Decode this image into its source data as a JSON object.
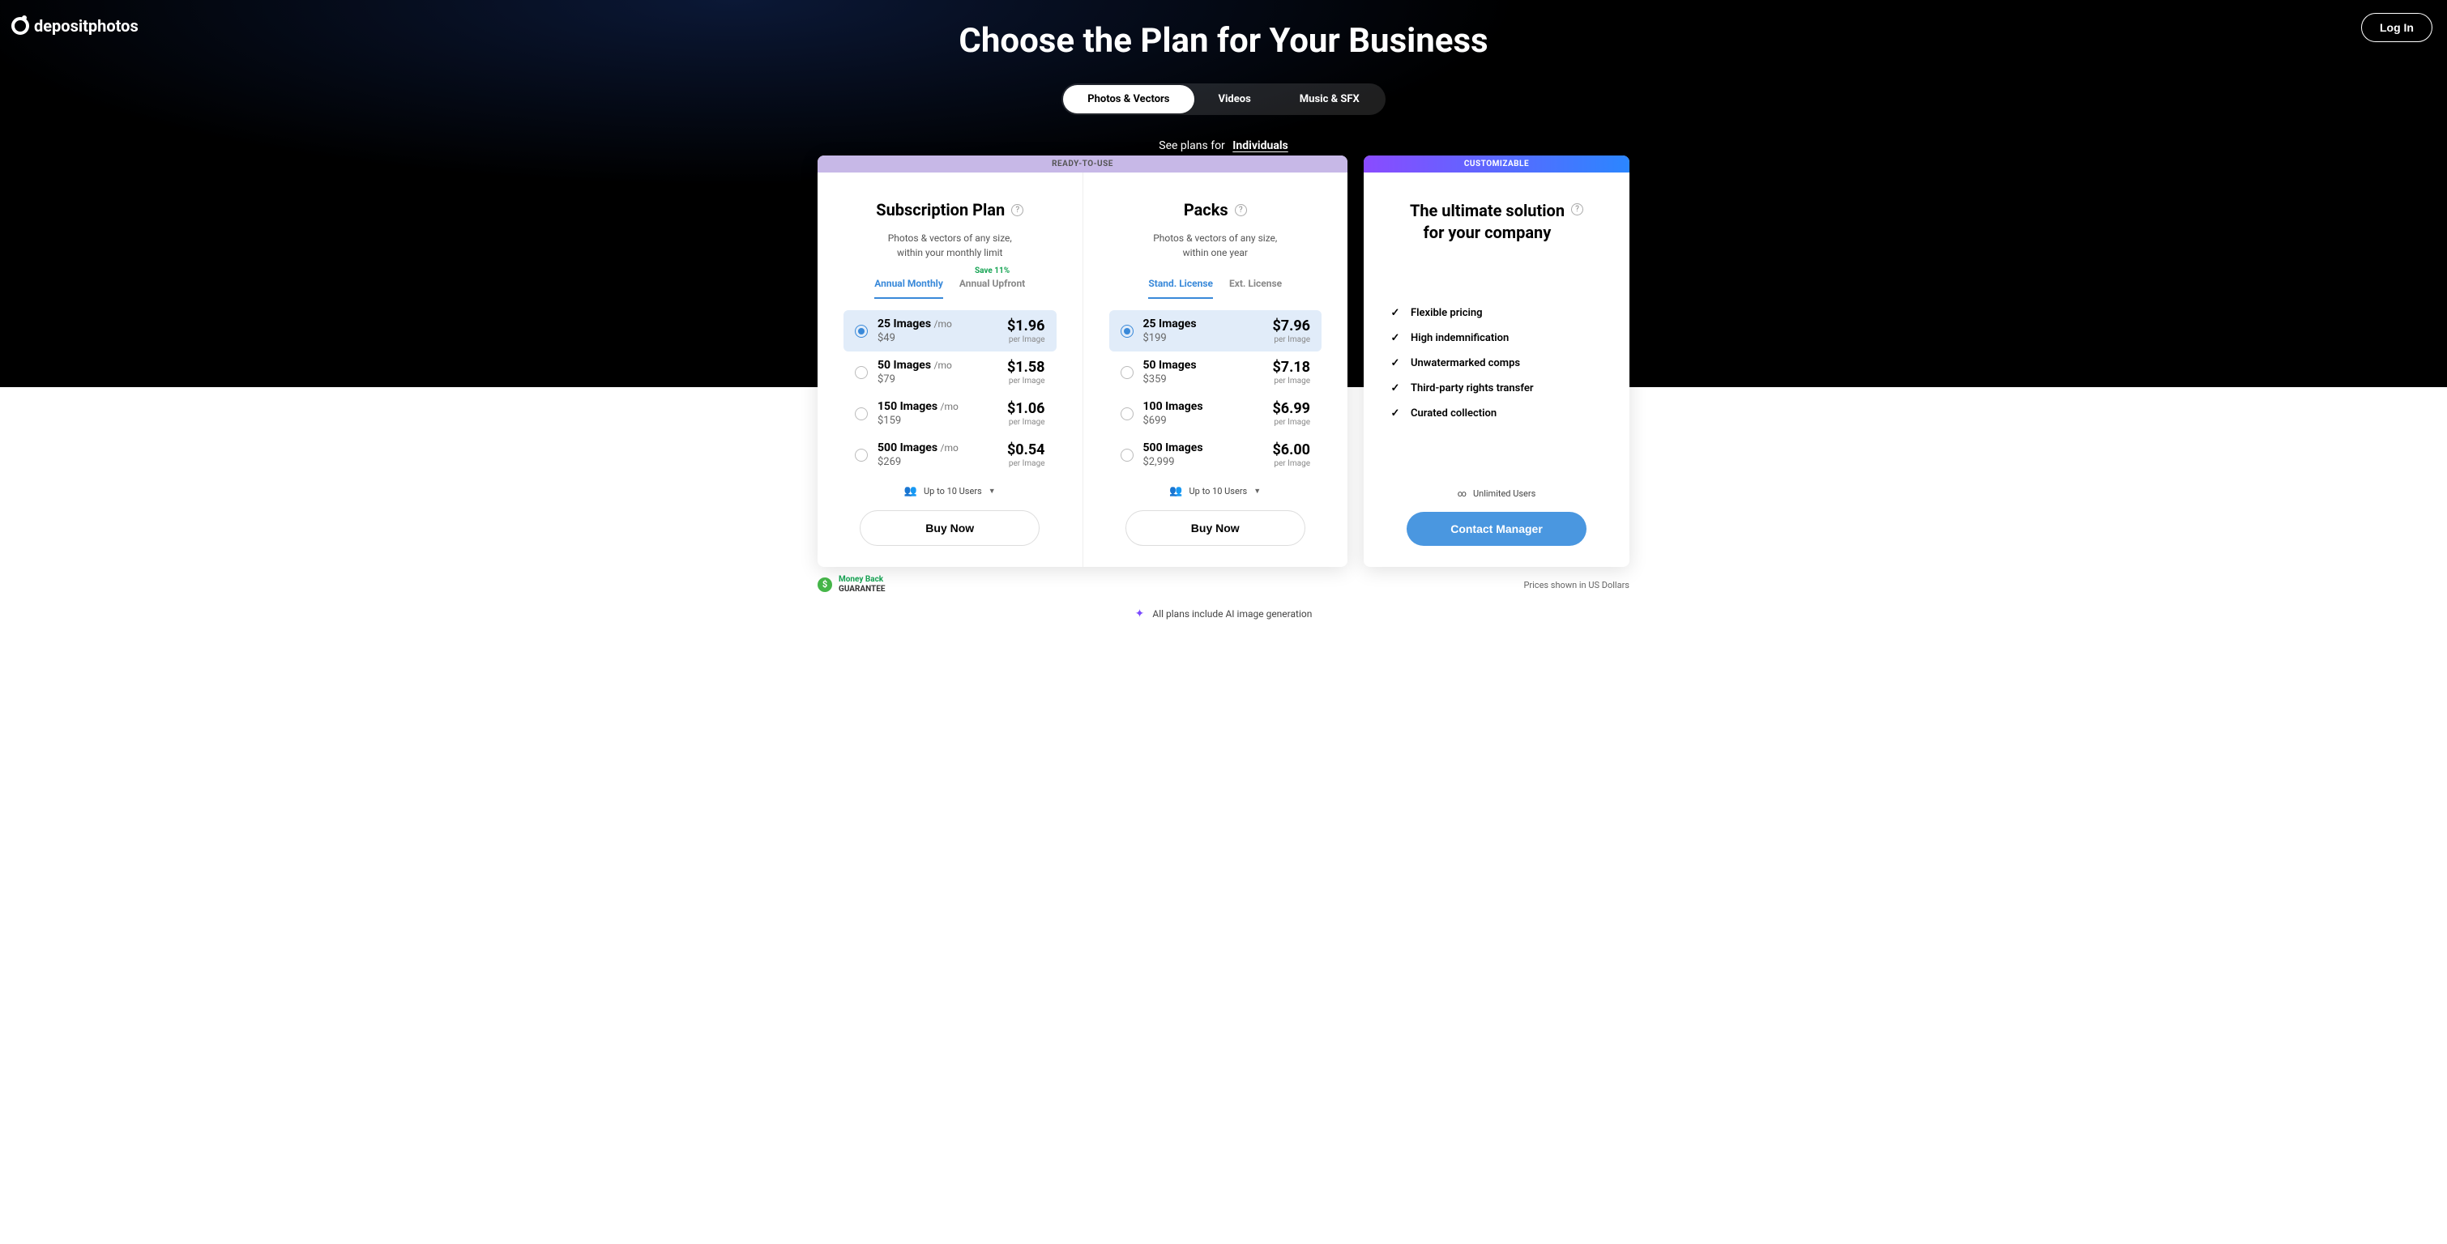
{
  "brand": "depositphotos",
  "login": "Log In",
  "hero_title": "Choose the Plan for Your Business",
  "tabs": {
    "photos": "Photos & Vectors",
    "videos": "Videos",
    "music": "Music & SFX"
  },
  "see_plans": {
    "prefix": "See plans for",
    "link": "Individuals"
  },
  "banners": {
    "ready": "READY-TO-USE",
    "custom": "CUSTOMIZABLE"
  },
  "subscription": {
    "title": "Subscription Plan",
    "sub1": "Photos & vectors of any size,",
    "sub2": "within your monthly limit",
    "tab1": "Annual Monthly",
    "tab2": "Annual Upfront",
    "save": "Save 11%",
    "per": "per Image",
    "mo": "/mo",
    "options": [
      {
        "name": "25 Images",
        "total": "$49",
        "price": "$1.96"
      },
      {
        "name": "50 Images",
        "total": "$79",
        "price": "$1.58"
      },
      {
        "name": "150 Images",
        "total": "$159",
        "price": "$1.06"
      },
      {
        "name": "500 Images",
        "total": "$269",
        "price": "$0.54"
      }
    ],
    "users": "Up to 10 Users",
    "buy": "Buy Now"
  },
  "packs": {
    "title": "Packs",
    "sub1": "Photos & vectors of any size,",
    "sub2": "within one year",
    "tab1": "Stand. License",
    "tab2": "Ext. License",
    "per": "per Image",
    "options": [
      {
        "name": "25 Images",
        "total": "$199",
        "price": "$7.96"
      },
      {
        "name": "50 Images",
        "total": "$359",
        "price": "$7.18"
      },
      {
        "name": "100 Images",
        "total": "$699",
        "price": "$6.99"
      },
      {
        "name": "500 Images",
        "total": "$2,999",
        "price": "$6.00"
      }
    ],
    "users": "Up to 10 Users",
    "buy": "Buy Now"
  },
  "ultimate": {
    "title1": "The ultimate solution",
    "title2": "for your company",
    "features": [
      "Flexible pricing",
      "High indemnification",
      "Unwatermarked comps",
      "Third-party rights transfer",
      "Curated collection"
    ],
    "unlimited": "Unlimited Users",
    "contact": "Contact Manager"
  },
  "footer": {
    "money1": "Money Back",
    "money2": "GUARANTEE",
    "currency": "Prices shown in US Dollars",
    "ai": "All plans include AI image generation"
  }
}
